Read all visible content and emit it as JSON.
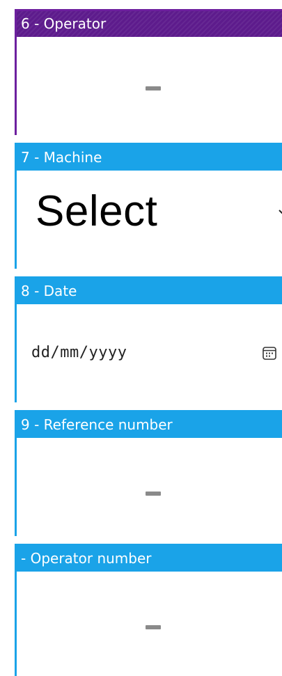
{
  "fields": [
    {
      "number": "6",
      "title": "6 - Operator",
      "value": "-"
    },
    {
      "number": "7",
      "title": "7 - Machine",
      "select_value": "Select"
    },
    {
      "number": "8",
      "title": "8 - Date",
      "placeholder": "dd/mm/yyyy"
    },
    {
      "number": "9",
      "title": "9 - Reference number",
      "value": "-"
    },
    {
      "number": "",
      "title": "- Operator number",
      "value": "-"
    }
  ],
  "colors": {
    "active_header": "#5d1b8c",
    "header": "#1aa3e8",
    "dash": "#8a8a8a"
  },
  "icons": {
    "dropdown": "chevron-down-icon",
    "date_picker": "calendar-icon"
  }
}
